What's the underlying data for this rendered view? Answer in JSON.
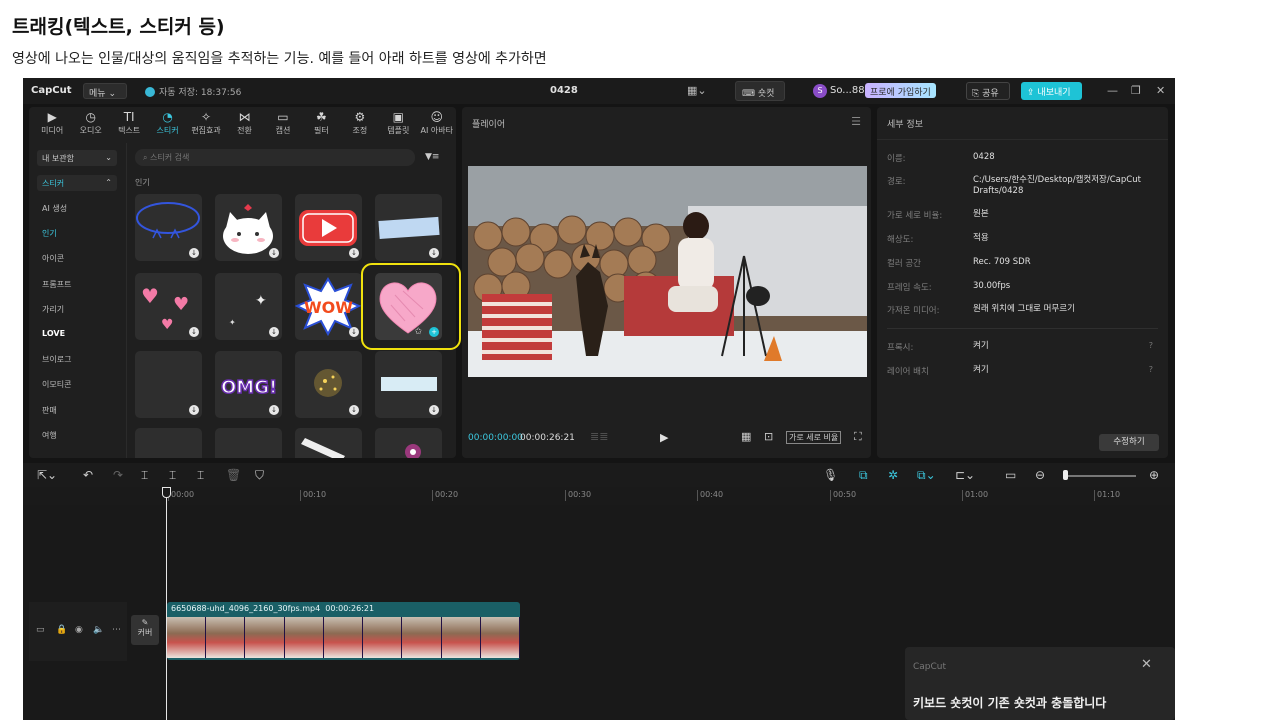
{
  "doc": {
    "title": "트래킹(텍스트, 스티커 등)",
    "description": "영상에 나오는 인물/대상의 움직임을 추적하는 기능. 예를 들어 아래 하트를 영상에 추가하면"
  },
  "topbar": {
    "logo": "CapCut",
    "menu": "메뉴",
    "autosave": "자동 저장: 18:37:56",
    "project_title": "0428",
    "shortcut": "숏컷",
    "user_initial": "S",
    "username": "So...88",
    "pro": "프로에 가입하기",
    "share": "공유",
    "export": "내보내기"
  },
  "tabs": [
    {
      "label": "미디어",
      "icon": "▶"
    },
    {
      "label": "오디오",
      "icon": "◷"
    },
    {
      "label": "텍스트",
      "icon": "TI"
    },
    {
      "label": "스티커",
      "icon": "◔"
    },
    {
      "label": "편집효과",
      "icon": "✧"
    },
    {
      "label": "전환",
      "icon": "⋈"
    },
    {
      "label": "캡션",
      "icon": "▭"
    },
    {
      "label": "필터",
      "icon": "☘"
    },
    {
      "label": "조정",
      "icon": "⚙"
    },
    {
      "label": "템플릿",
      "icon": "▣"
    },
    {
      "label": "AI 아바타",
      "icon": "☺"
    }
  ],
  "sidebar": {
    "select": "내 보관함",
    "sticker": "스티커",
    "items": [
      "AI 생성",
      "인기",
      "아이콘",
      "프롬프트",
      "가리기",
      "LOVE",
      "브이로그",
      "이모티콘",
      "판매",
      "여행"
    ]
  },
  "sticker_panel": {
    "search_placeholder": "스티커 검색",
    "filter": "▼≡",
    "section": "인기",
    "omg": "OMG!",
    "wow": "WOW"
  },
  "player": {
    "title": "플레이어",
    "time_current": "00:00:00:00",
    "time_total": "00:00:26:21",
    "ratio": "가로 세로 비율"
  },
  "details": {
    "title": "세부 정보",
    "rows": [
      {
        "label": "이름:",
        "value": "0428"
      },
      {
        "label": "경로:",
        "value": "C:/Users/한수진/Desktop/캡컷저장/CapCut Drafts/0428"
      },
      {
        "label": "가로 세로 비율:",
        "value": "원본"
      },
      {
        "label": "해상도:",
        "value": "적용"
      },
      {
        "label": "컬러 공간",
        "value": "Rec. 709 SDR"
      },
      {
        "label": "프레임 속도:",
        "value": "30.00fps"
      },
      {
        "label": "가져온 미디어:",
        "value": "원래 위치에 그대로 머무르기"
      }
    ],
    "rows2": [
      {
        "label": "프록시:",
        "value": "켜기"
      },
      {
        "label": "레이어 배치",
        "value": "켜기"
      }
    ],
    "modify": "수정하기"
  },
  "timeline": {
    "ticks": [
      "00:00",
      "00:10",
      "00:20",
      "00:30",
      "00:40",
      "00:50",
      "01:00",
      "01:10"
    ],
    "cover": "커버",
    "clip_name": "6650688-uhd_4096_2160_30fps.mp4",
    "clip_duration": "00:00:26:21"
  },
  "toast": {
    "logo": "CapCut",
    "message": "키보드 숏컷이 기존 숏컷과 충돌합니다"
  },
  "colors": {
    "accent": "#3cc8df",
    "highlight": "#f0e20e",
    "heart_pink": "#f7a8c9"
  }
}
